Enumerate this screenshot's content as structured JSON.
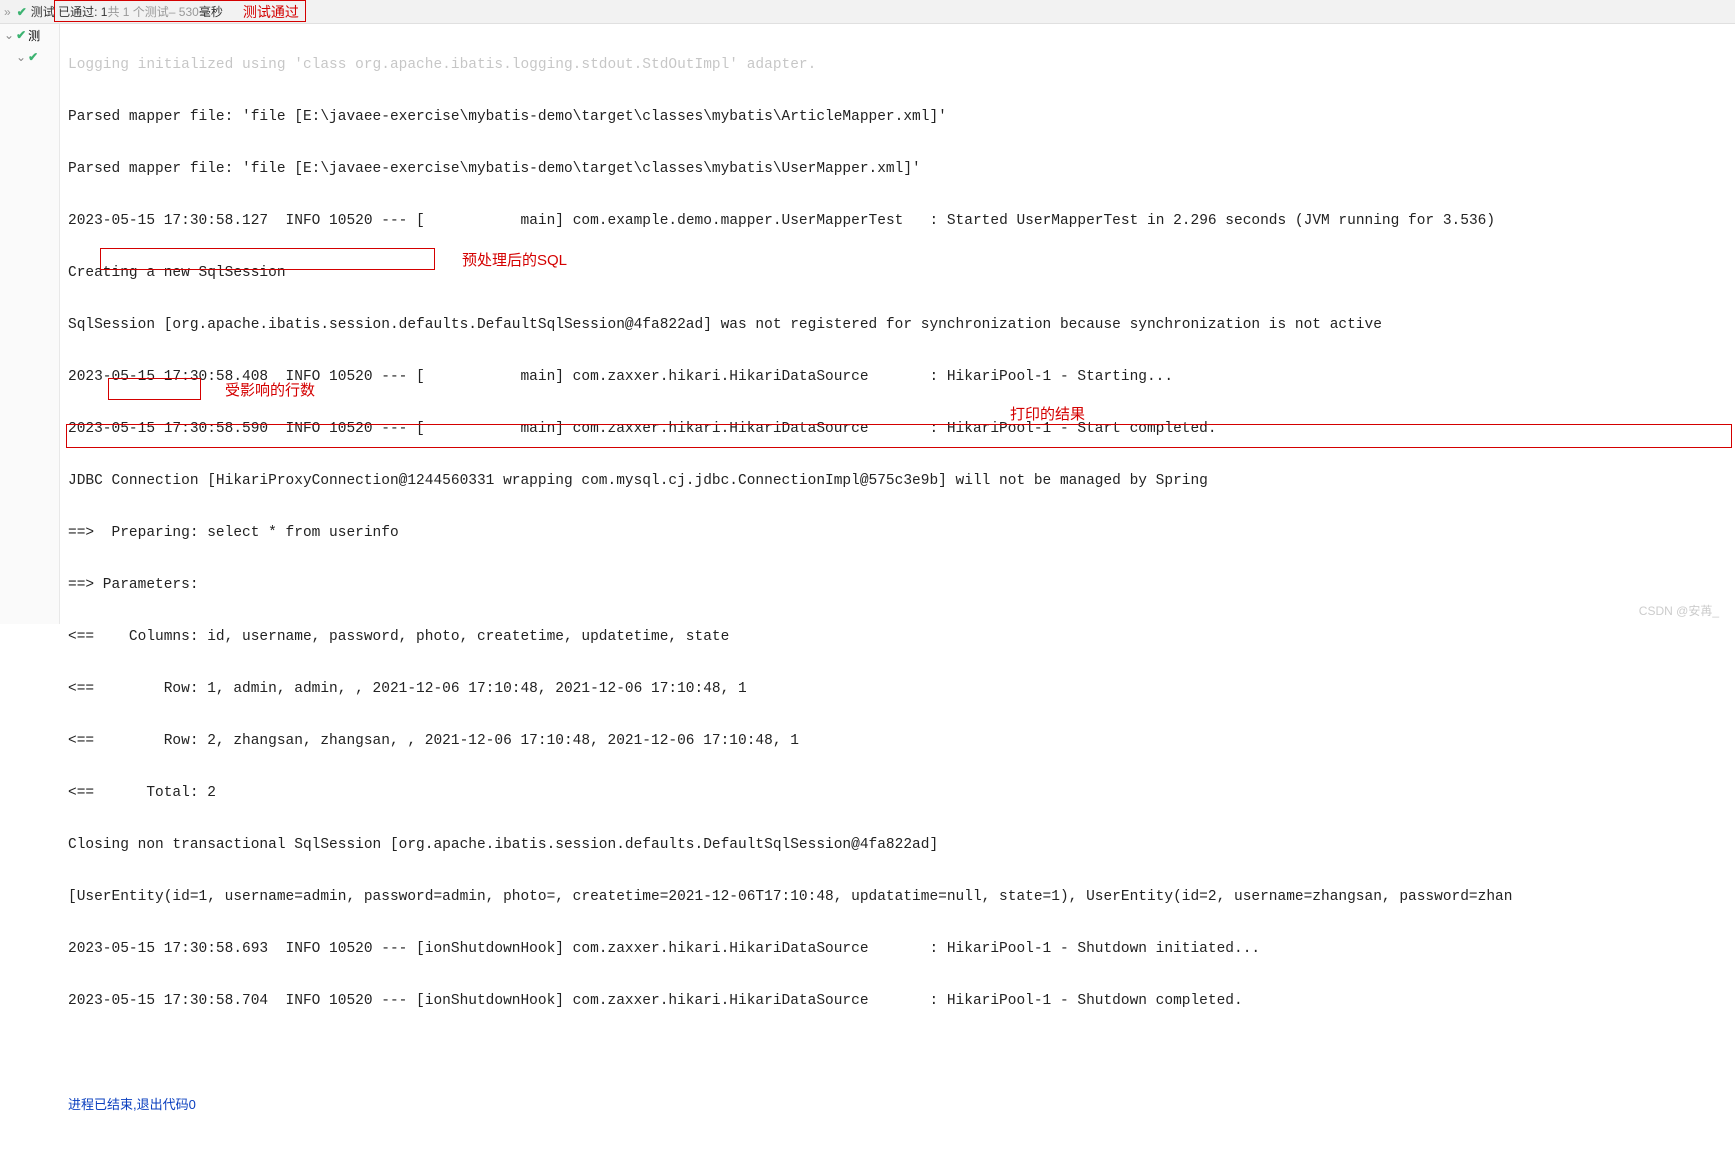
{
  "topbar": {
    "pass_prefix": "测试 已通过: 1",
    "pass_middle": "共 1 个测试",
    "pass_suffix": " – 530",
    "pass_unit": "毫秒",
    "annot": "测试通过"
  },
  "sidebar": {
    "item": "测"
  },
  "annot": {
    "sql": "预处理后的SQL",
    "rows": "受影响的行数",
    "result": "打印的结果"
  },
  "log": {
    "l0": "Logging initialized using 'class org.apache.ibatis.logging.stdout.StdOutImpl' adapter.",
    "l1": "Parsed mapper file: 'file [E:\\javaee-exercise\\mybatis-demo\\target\\classes\\mybatis\\ArticleMapper.xml]'",
    "l2": "Parsed mapper file: 'file [E:\\javaee-exercise\\mybatis-demo\\target\\classes\\mybatis\\UserMapper.xml]'",
    "l3a": "2023-05-15 17:30:58.127  INFO 10520 --- [           m",
    "l3b": "ain] com.example.demo.mapper.UserMapperTest   : Started UserMapperTest in 2.296 seconds (JVM running for 3.536)",
    "l4": "Creating a new SqlSession",
    "l5": "SqlSession [org.apache.ibatis.session.defaults.DefaultSqlSession@4fa822ad] was not registered for synchronization because synchronization is not active",
    "l6": "2023-05-15 17:30:58.408  INFO 10520 --- [           main] com.zaxxer.hikari.HikariDataSource       : HikariPool-1 - Starting...",
    "l7": "2023-05-15 17:30:58.590  INFO 10520 --- [           main] com.zaxxer.hikari.HikariDataSource       : HikariPool-1 - Start completed.",
    "l8": "JDBC Connection [HikariProxyConnection@1244560331 wrapping com.mysql.cj.jdbc.ConnectionImpl@575c3e9b] will not be managed by Spring",
    "l9": "==>  Preparing: select * from userinfo",
    "l10": "==> Parameters:",
    "l11": "<==    Columns: id, username, password, photo, createtime, updatetime, state",
    "l12": "<==        Row: 1, admin, admin, , 2021-12-06 17:10:48, 2021-12-06 17:10:48, 1",
    "l13": "<==        Row: 2, zhangsan, zhangsan, , 2021-12-06 17:10:48, 2021-12-06 17:10:48, 1",
    "l14": "<==      Total: 2",
    "l15": "Closing non transactional SqlSession [org.apache.ibatis.session.defaults.DefaultSqlSession@4fa822ad]",
    "l16": "[UserEntity(id=1, username=admin, password=admin, photo=, createtime=2021-12-06T17:10:48, updatatime=null, state=1), UserEntity(id=2, username=zhangsan, password=zhan",
    "l17": "2023-05-15 17:30:58.693  INFO 10520 --- [ionShutdownHook] com.zaxxer.hikari.HikariDataSource       : HikariPool-1 - Shutdown initiated...",
    "l18": "2023-05-15 17:30:58.704  INFO 10520 --- [ionShutdownHook] com.zaxxer.hikari.HikariDataSource       : HikariPool-1 - Shutdown completed.",
    "exit": "进程已结束,退出代码0"
  },
  "watermark": "CSDN @安苒_"
}
